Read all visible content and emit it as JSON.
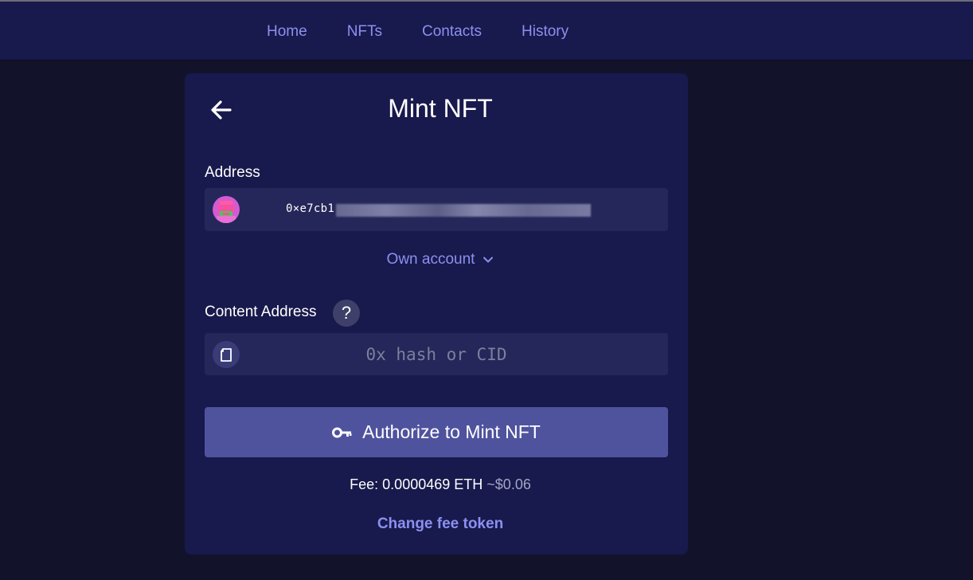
{
  "nav": {
    "items": [
      {
        "label": "Home"
      },
      {
        "label": "NFTs"
      },
      {
        "label": "Contacts"
      },
      {
        "label": "History"
      }
    ]
  },
  "card": {
    "title": "Mint NFT",
    "address": {
      "label": "Address",
      "value": "0×e7cb1"
    },
    "own_account": {
      "label": "Own account"
    },
    "content_address": {
      "label": "Content Address",
      "help_glyph": "?",
      "placeholder": "0x hash or CID"
    },
    "authorize_button": {
      "label": "Authorize to Mint NFT"
    },
    "fee": {
      "prefix": "Fee: ",
      "amount": "0.0000469 ETH",
      "usd": "~$0.06"
    },
    "change_fee": {
      "label": "Change fee token"
    }
  },
  "colors": {
    "page_background": "#12132a",
    "panel": "#18194c",
    "field": "#25275a",
    "accent_link": "#8b90f0",
    "button": "#4f539e"
  },
  "icons": {
    "back": "arrow-left-icon",
    "avatar": "pixel-avatar",
    "chevron": "chevron-down-icon",
    "help": "question-icon",
    "document": "document-icon",
    "key": "key-icon"
  }
}
